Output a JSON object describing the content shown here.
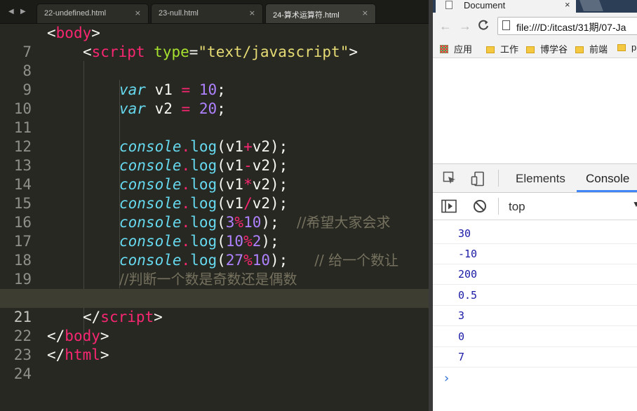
{
  "editor": {
    "tabs": [
      {
        "label": "22-undefined.html",
        "active": false
      },
      {
        "label": "23-null.html",
        "active": false
      },
      {
        "label": "24-算术运算符.html",
        "active": true
      }
    ],
    "nav_left": "◀",
    "nav_right": "▶",
    "close_glyph": "×",
    "current_line": 21,
    "lines": [
      {
        "n": "7"
      },
      {
        "n": "8"
      },
      {
        "n": "9"
      },
      {
        "n": "10"
      },
      {
        "n": "11"
      },
      {
        "n": "12"
      },
      {
        "n": "13"
      },
      {
        "n": "14"
      },
      {
        "n": "15"
      },
      {
        "n": "16"
      },
      {
        "n": "17"
      },
      {
        "n": "18"
      },
      {
        "n": "19"
      },
      {
        "n": "20"
      },
      {
        "n": "21"
      },
      {
        "n": "22"
      },
      {
        "n": "23"
      },
      {
        "n": "24"
      }
    ],
    "code": {
      "l7": {
        "open": "<",
        "tag": "body",
        "close": ">"
      },
      "l8": {
        "open": "<",
        "tag": "script",
        "attr": "type",
        "eq": "=",
        "str": "\"text/javascript\"",
        "close": ">"
      },
      "l10": {
        "kw": "var",
        "name": "v1",
        "op": "=",
        "num": "10",
        "semi": ";"
      },
      "l11": {
        "kw": "var",
        "name": "v2",
        "op": "=",
        "num": "20",
        "semi": ";"
      },
      "l13": {
        "obj": "console",
        "dot": ".",
        "fn": "log",
        "p1": "(",
        "a": "v1",
        "op": "+",
        "b": "v2",
        "p2": ");"
      },
      "l14": {
        "obj": "console",
        "dot": ".",
        "fn": "log",
        "p1": "(",
        "a": "v1",
        "op": "-",
        "b": "v2",
        "p2": ");"
      },
      "l15": {
        "obj": "console",
        "dot": ".",
        "fn": "log",
        "p1": "(",
        "a": "v1",
        "op": "*",
        "b": "v2",
        "p2": ");"
      },
      "l16": {
        "obj": "console",
        "dot": ".",
        "fn": "log",
        "p1": "(",
        "a": "v1",
        "op": "/",
        "b": "v2",
        "p2": ");"
      },
      "l17": {
        "obj": "console",
        "dot": ".",
        "fn": "log",
        "p1": "(",
        "a": "3",
        "op": "%",
        "b": "10",
        "p2": ");",
        "comment": "//希望大家会求"
      },
      "l18": {
        "obj": "console",
        "dot": ".",
        "fn": "log",
        "p1": "(",
        "a": "10",
        "op": "%",
        "b": "2",
        "p2": ");"
      },
      "l19": {
        "obj": "console",
        "dot": ".",
        "fn": "log",
        "p1": "(",
        "a": "27",
        "op": "%",
        "b": "10",
        "p2": ");",
        "comment": "// 给一个数让"
      },
      "l20": {
        "comment": "//判断一个数是奇数还是偶数"
      },
      "l22": {
        "open": "</",
        "tag": "script",
        "close": ">"
      },
      "l23": {
        "open": "</",
        "tag": "body",
        "close": ">"
      },
      "l24": {
        "open": "</",
        "tag": "html",
        "close": ">"
      }
    }
  },
  "browser": {
    "tab_title": "Document",
    "tab_close": "×",
    "back": "←",
    "forward": "→",
    "reload": "C",
    "address": "file:///D:/itcast/31期/07-Ja",
    "bookmarks": [
      "应用",
      "工作",
      "博学谷",
      "前端",
      "p"
    ],
    "devtools": {
      "tabs": [
        "Elements",
        "Console"
      ],
      "active_tab": "Console",
      "context": "top",
      "context_arrow": "▼",
      "logs": [
        "30",
        "-10",
        "200",
        "0.5",
        "3",
        "0",
        "7"
      ],
      "prompt": "›"
    }
  },
  "colors": {
    "editor_bg": "#272822",
    "tag": "#f92672",
    "attr": "#a6e22e",
    "string": "#e6db74",
    "number": "#ae81ff",
    "keyword": "#66d9ef",
    "comment": "#75715e",
    "console_number": "#1a1aa6",
    "devtools_accent": "#4285f4"
  }
}
